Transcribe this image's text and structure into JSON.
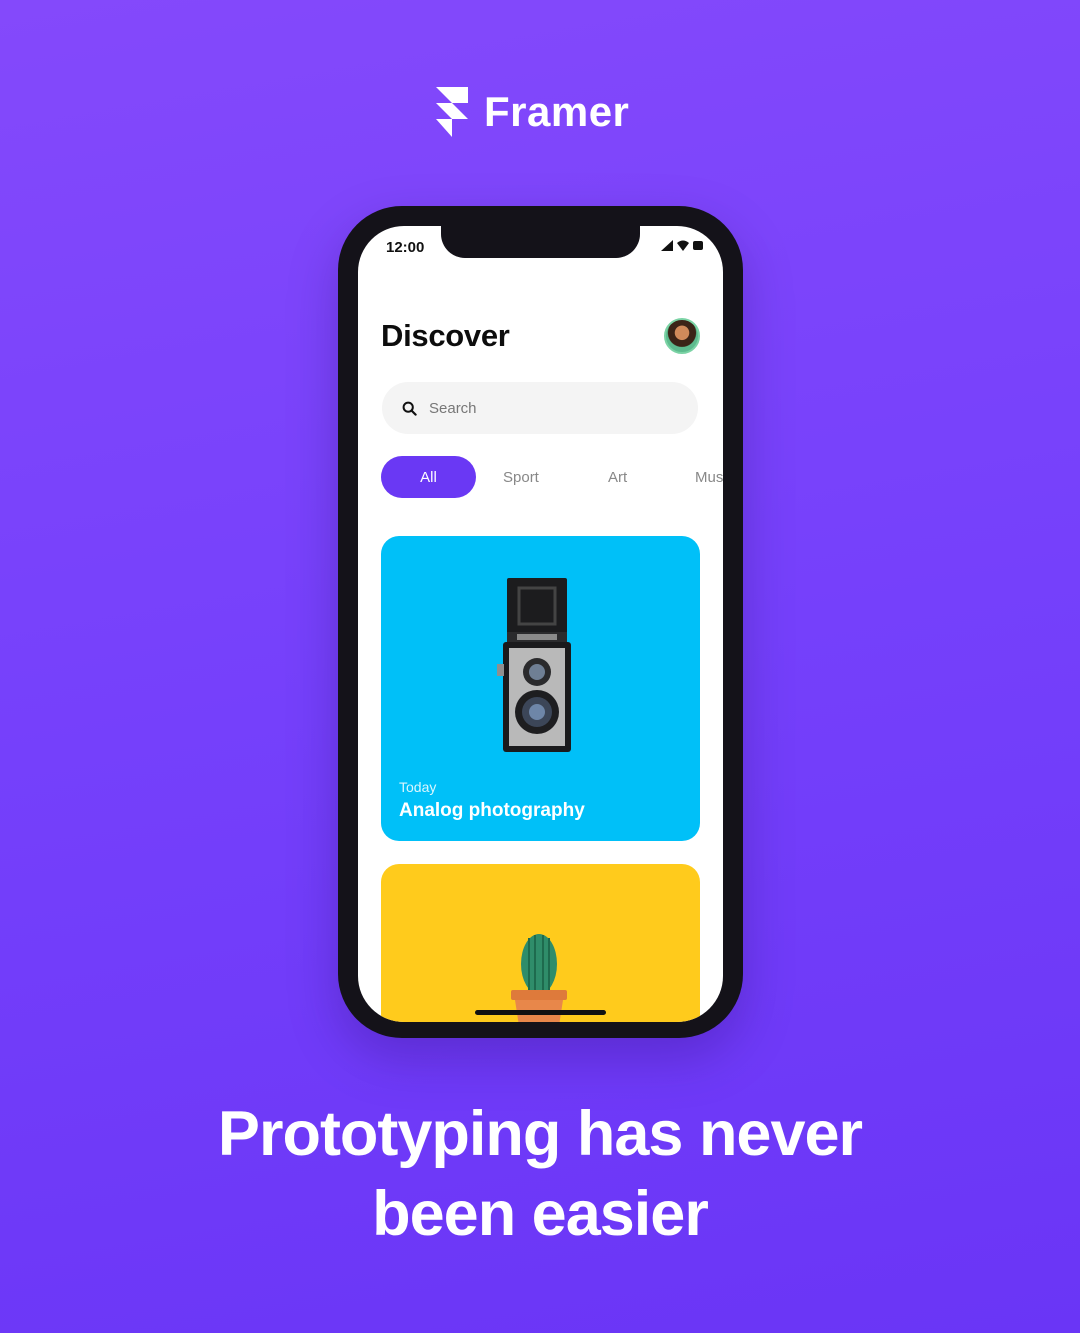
{
  "brand": {
    "name": "Framer"
  },
  "status_bar": {
    "time": "12:00"
  },
  "app": {
    "title": "Discover",
    "search": {
      "placeholder": "Search"
    },
    "categories": [
      {
        "label": "All",
        "selected": true
      },
      {
        "label": "Sport",
        "selected": false
      },
      {
        "label": "Art",
        "selected": false
      },
      {
        "label": "Mus",
        "selected": false
      }
    ],
    "cards": [
      {
        "kicker": "Today",
        "title": "Analog photography",
        "color": "#00c0f8"
      },
      {
        "color": "#ffcb1c"
      }
    ]
  },
  "headline": {
    "line1": "Prototyping has never",
    "line2": "been easier"
  },
  "colors": {
    "background": "#7540fb",
    "accent": "#6a38f4"
  }
}
